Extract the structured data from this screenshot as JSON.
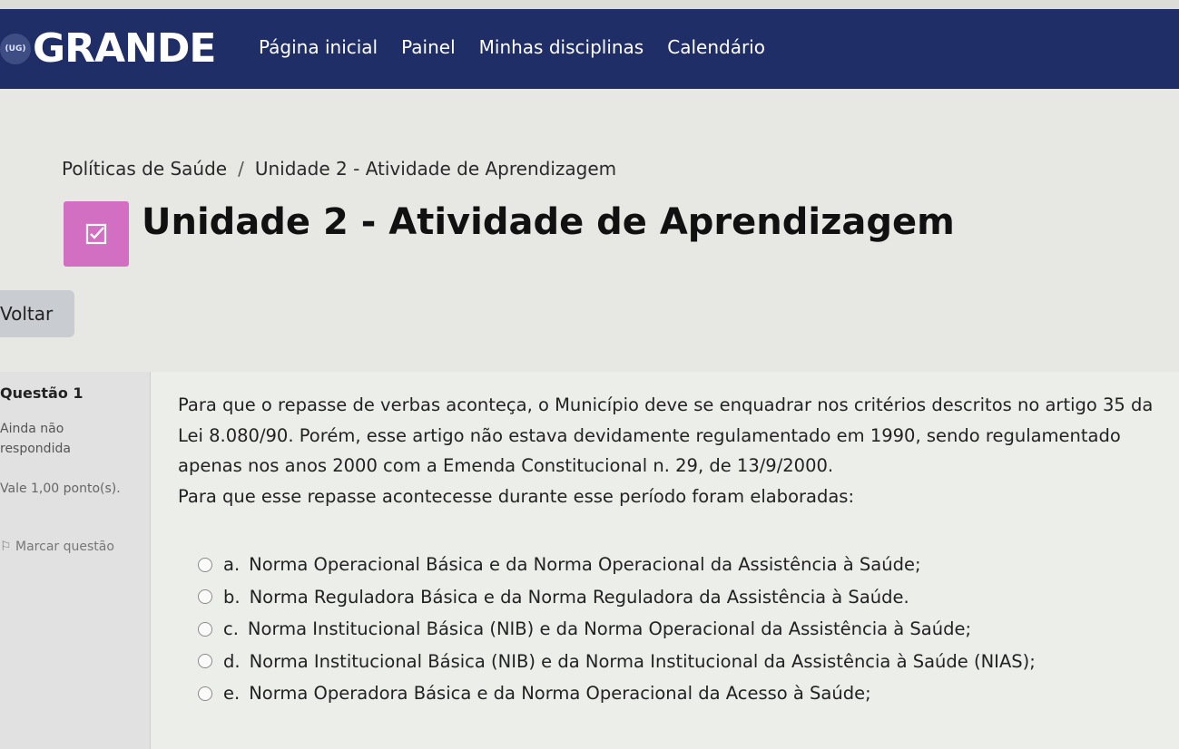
{
  "navbar": {
    "logo_badge": "(UG)",
    "logo_text": "GRANDE",
    "links": [
      "Página inicial",
      "Painel",
      "Minhas disciplinas",
      "Calendário"
    ]
  },
  "breadcrumb": {
    "items": [
      "Políticas de Saúde",
      "Unidade 2 - Atividade de Aprendizagem"
    ],
    "separator": "/"
  },
  "page": {
    "title": "Unidade 2 - Atividade de Aprendizagem",
    "back_label": "Voltar",
    "accent_color": "#d36fc2",
    "navbar_color": "#1f2e66"
  },
  "question": {
    "number_label": "Questão 1",
    "status": "Ainda não respondida",
    "grade": "Vale 1,00 ponto(s).",
    "flag": "Marcar questão",
    "text": "Para que o repasse de verbas aconteça, o Município deve se enquadrar nos critérios descritos no artigo 35 da Lei 8.080/90. Porém, esse artigo não estava devidamente regulamentado em 1990, sendo regulamentado apenas nos anos 2000 com a Emenda Constitucional n. 29, de 13/9/2000.",
    "prompt": "Para que esse repasse acontecesse durante esse período foram elaboradas:",
    "answers": [
      {
        "letter": "a.",
        "text": "Norma Operacional Básica e da Norma Operacional da Assistência à Saúde;"
      },
      {
        "letter": "b.",
        "text": "Norma Reguladora Básica e da Norma Reguladora da Assistência à Saúde."
      },
      {
        "letter": "c.",
        "text": "Norma Institucional Básica (NIB) e da Norma Operacional da Assistência à Saúde;"
      },
      {
        "letter": "d.",
        "text": "Norma Institucional Básica (NIB) e da Norma Institucional da Assistência à Saúde (NIAS);"
      },
      {
        "letter": "e.",
        "text": "Norma Operadora Básica e da Norma Operacional da Acesso à Saúde;"
      }
    ]
  }
}
